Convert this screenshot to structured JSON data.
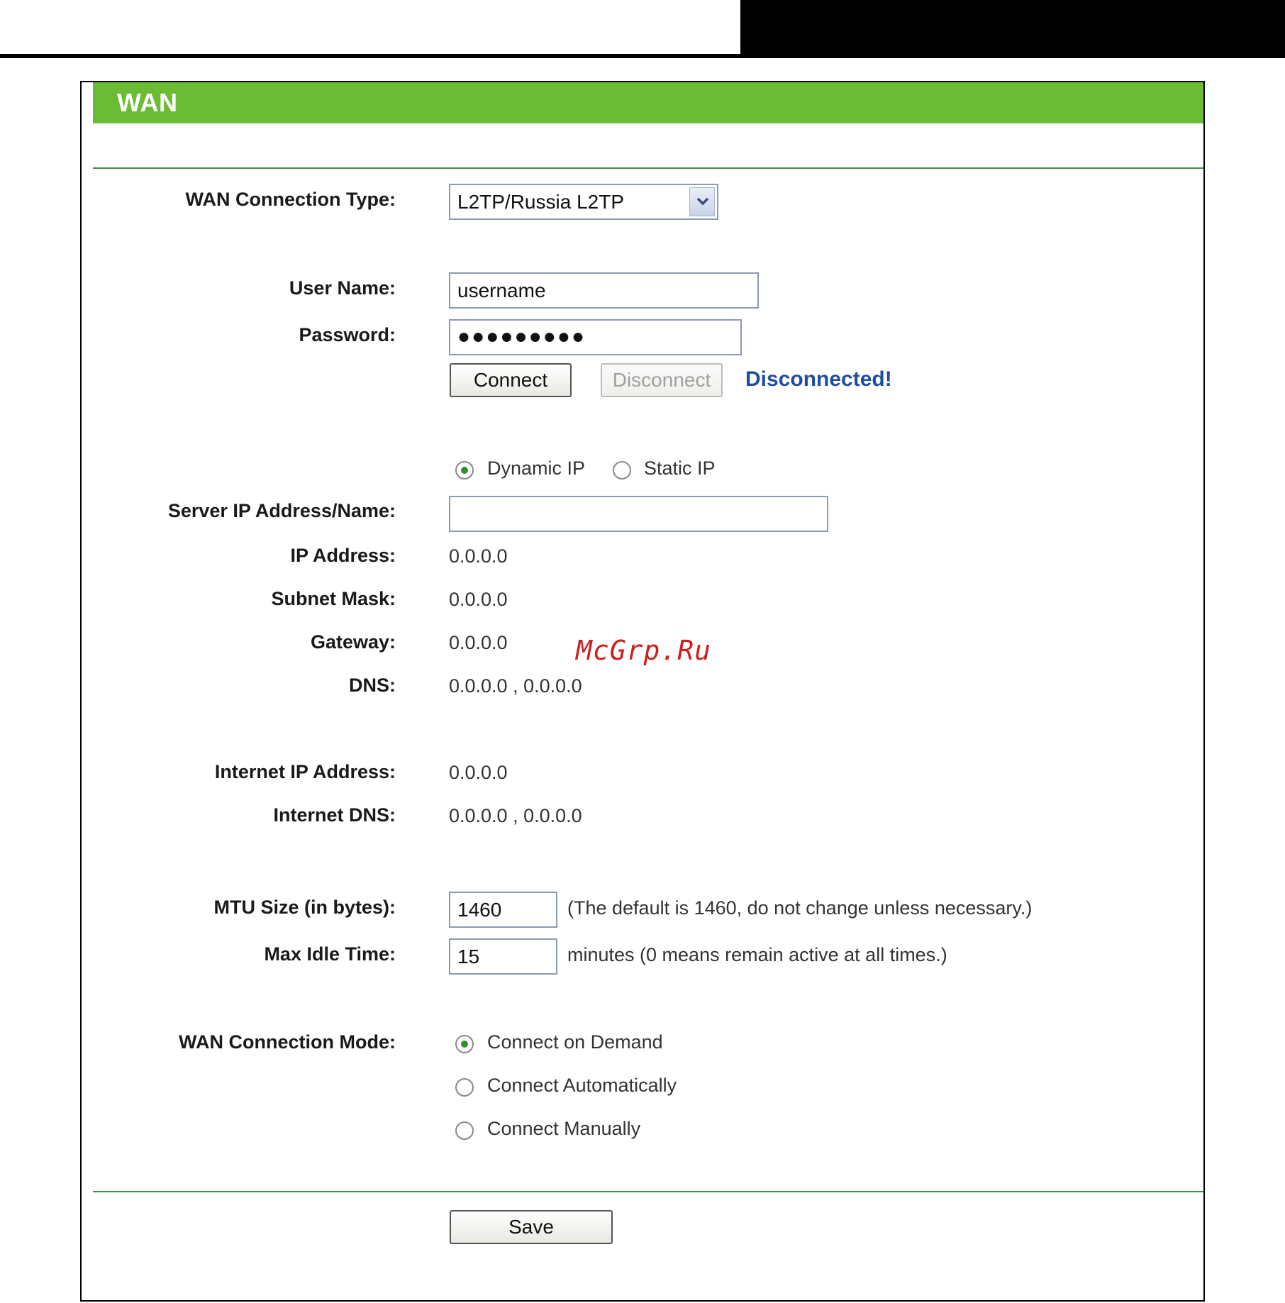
{
  "panel": {
    "title": "WAN"
  },
  "labels": {
    "connection_type": "WAN Connection Type:",
    "user_name": "User Name:",
    "password": "Password:",
    "server_ip": "Server IP Address/Name:",
    "ip_address": "IP Address:",
    "subnet_mask": "Subnet Mask:",
    "gateway": "Gateway:",
    "dns": "DNS:",
    "internet_ip": "Internet IP Address:",
    "internet_dns": "Internet DNS:",
    "mtu": "MTU Size (in bytes):",
    "max_idle": "Max Idle Time:",
    "connection_mode": "WAN Connection Mode:"
  },
  "connection_type": {
    "selected": "L2TP/Russia L2TP"
  },
  "credentials": {
    "user_name": "username",
    "password_masked": "●●●●●●●●●"
  },
  "buttons": {
    "connect": "Connect",
    "disconnect": "Disconnect",
    "save": "Save"
  },
  "status_text": "Disconnected!",
  "ip_mode": {
    "dynamic": "Dynamic IP",
    "static": "Static IP",
    "selected": "dynamic"
  },
  "server_ip": {
    "value": ""
  },
  "values": {
    "ip_address": "0.0.0.0",
    "subnet_mask": "0.0.0.0",
    "gateway": "0.0.0.0",
    "dns": "0.0.0.0 , 0.0.0.0",
    "internet_ip": "0.0.0.0",
    "internet_dns": "0.0.0.0 , 0.0.0.0"
  },
  "mtu": {
    "value": "1460",
    "hint": "(The default is 1460, do not change unless necessary.)"
  },
  "max_idle": {
    "value": "15",
    "hint": "minutes (0 means remain active at all times.)"
  },
  "connection_mode": {
    "options": [
      "Connect on Demand",
      "Connect Automatically",
      "Connect Manually"
    ],
    "selected": 0
  },
  "watermark": "McGrp.Ru",
  "colors": {
    "title_bar": "#6cbb35",
    "rule": "#3f9144",
    "status": "#1f4e9e",
    "watermark": "#cc1f1f"
  }
}
